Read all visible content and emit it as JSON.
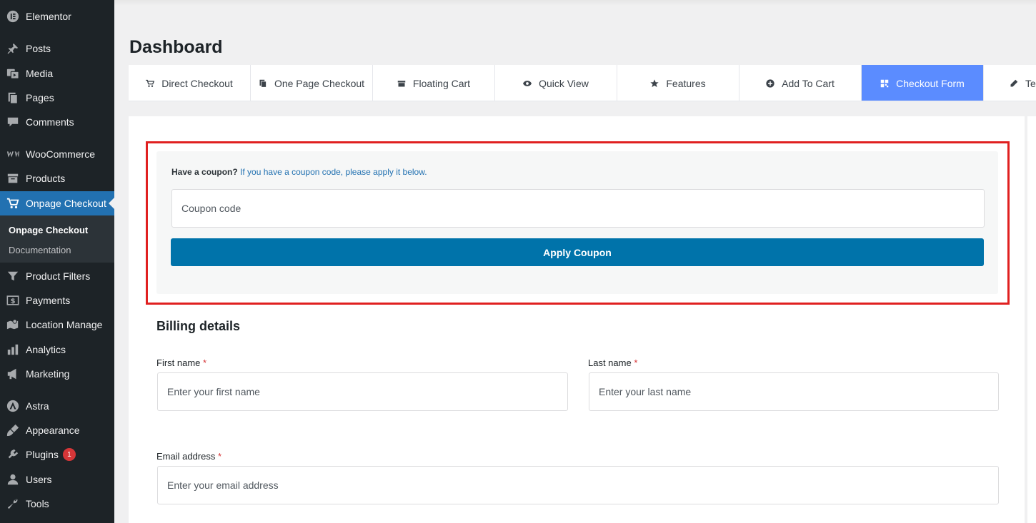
{
  "sidebar": {
    "items": [
      {
        "label": "Elementor",
        "icon": "elementor-icon"
      },
      {
        "label": "Posts",
        "icon": "pin-icon"
      },
      {
        "label": "Media",
        "icon": "media-icon"
      },
      {
        "label": "Pages",
        "icon": "pages-icon"
      },
      {
        "label": "Comments",
        "icon": "comment-icon"
      },
      {
        "label": "WooCommerce",
        "icon": "woocommerce-icon"
      },
      {
        "label": "Products",
        "icon": "archive-icon"
      },
      {
        "label": "Onpage Checkout",
        "icon": "cart-icon"
      },
      {
        "label": "Product Filters",
        "icon": "filter-icon"
      },
      {
        "label": "Payments",
        "icon": "dollar-icon"
      },
      {
        "label": "Location Manage",
        "icon": "map-icon"
      },
      {
        "label": "Analytics",
        "icon": "chart-icon"
      },
      {
        "label": "Marketing",
        "icon": "megaphone-icon"
      },
      {
        "label": "Astra",
        "icon": "astra-icon"
      },
      {
        "label": "Appearance",
        "icon": "brush-icon"
      },
      {
        "label": "Plugins",
        "icon": "plugin-icon",
        "badge": "1"
      },
      {
        "label": "Users",
        "icon": "user-icon"
      },
      {
        "label": "Tools",
        "icon": "wrench-icon"
      }
    ],
    "submenu": [
      {
        "label": "Onpage Checkout"
      },
      {
        "label": "Documentation"
      }
    ]
  },
  "header": {
    "title": "Dashboard"
  },
  "tabs": [
    {
      "label": "Direct Checkout",
      "icon": "cart-icon"
    },
    {
      "label": "One Page Checkout",
      "icon": "copy-icon"
    },
    {
      "label": "Floating Cart",
      "icon": "box-icon"
    },
    {
      "label": "Quick View",
      "icon": "eye-icon"
    },
    {
      "label": "Features",
      "icon": "star-icon"
    },
    {
      "label": "Add To Cart",
      "icon": "plus-circle-icon"
    },
    {
      "label": "Checkout Form",
      "icon": "grid-icon"
    },
    {
      "label": "Tex",
      "icon": "pencil-icon"
    }
  ],
  "coupon": {
    "question": "Have a coupon?",
    "link": "If you have a coupon code, please apply it below.",
    "placeholder": "Coupon code",
    "button": "Apply Coupon"
  },
  "billing": {
    "title": "Billing details",
    "first_name_label": "First name",
    "first_name_placeholder": "Enter your first name",
    "last_name_label": "Last name",
    "last_name_placeholder": "Enter your last name",
    "email_label": "Email address",
    "email_placeholder": "Enter your email address",
    "required_mark": "*"
  },
  "colors": {
    "sidebar_bg": "#1d2327",
    "active_menu": "#2271b1",
    "active_tab": "#5b8cff",
    "apply_button": "#0073aa",
    "highlight_border": "#e02020"
  }
}
